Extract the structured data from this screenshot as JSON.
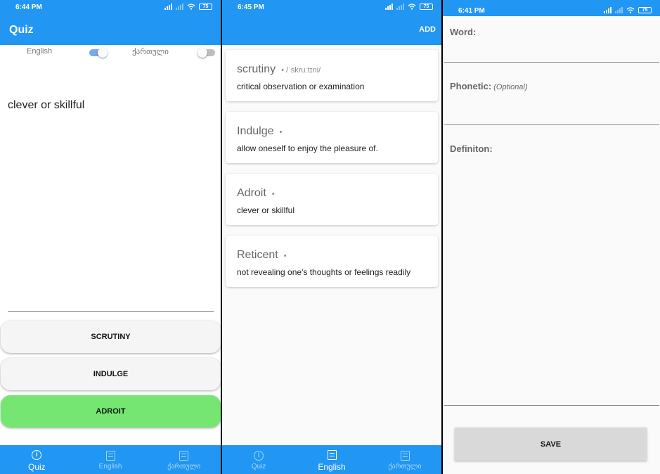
{
  "colors": {
    "primary": "#2196f3",
    "correct_answer": "#76e672",
    "switch_on": "#7aa7f0",
    "switch_off": "#bdbdbd",
    "save_button": "#d9d9d9"
  },
  "quiz_screen": {
    "status": {
      "time": "6:44 PM",
      "battery": "75"
    },
    "title": "Quiz",
    "switches": [
      {
        "label": "English",
        "on": true
      },
      {
        "label": "ქართული",
        "on": false
      }
    ],
    "question": "clever or skillful",
    "choices": [
      {
        "label": "SCRUTINY",
        "correct": false
      },
      {
        "label": "INDULGE",
        "correct": false
      },
      {
        "label": "ADROIT",
        "correct": true
      }
    ],
    "nav": [
      {
        "label": "Quiz",
        "icon": "info-icon",
        "active": true
      },
      {
        "label": "English",
        "icon": "list-icon",
        "active": false
      },
      {
        "label": "ქართული",
        "icon": "list-icon",
        "active": false
      }
    ]
  },
  "list_screen": {
    "status": {
      "time": "6:45 PM",
      "battery": "75"
    },
    "action": "ADD",
    "words": [
      {
        "word": "scrutiny",
        "phonetic": "/ˈskruːtɪni/",
        "definition": "critical observation or examination"
      },
      {
        "word": "Indulge",
        "phonetic": "",
        "definition": "allow oneself to enjoy the pleasure of."
      },
      {
        "word": "Adroit",
        "phonetic": "",
        "definition": "clever or skillful"
      },
      {
        "word": "Reticent",
        "phonetic": "",
        "definition": "not revealing one's thoughts or feelings readily"
      }
    ],
    "nav": [
      {
        "label": "Quiz",
        "icon": "info-icon",
        "active": false
      },
      {
        "label": "English",
        "icon": "list-icon",
        "active": true
      },
      {
        "label": "ქართული",
        "icon": "list-icon",
        "active": false
      }
    ]
  },
  "add_screen": {
    "status": {
      "time": "6:41 PM",
      "battery": "75"
    },
    "word_label": "Word:",
    "phonetic_label": "Phonetic:",
    "phonetic_hint": "(Optional)",
    "definition_label": "Definiton:",
    "word_value": "",
    "phonetic_value": "",
    "definition_value": "",
    "save_label": "SAVE"
  }
}
